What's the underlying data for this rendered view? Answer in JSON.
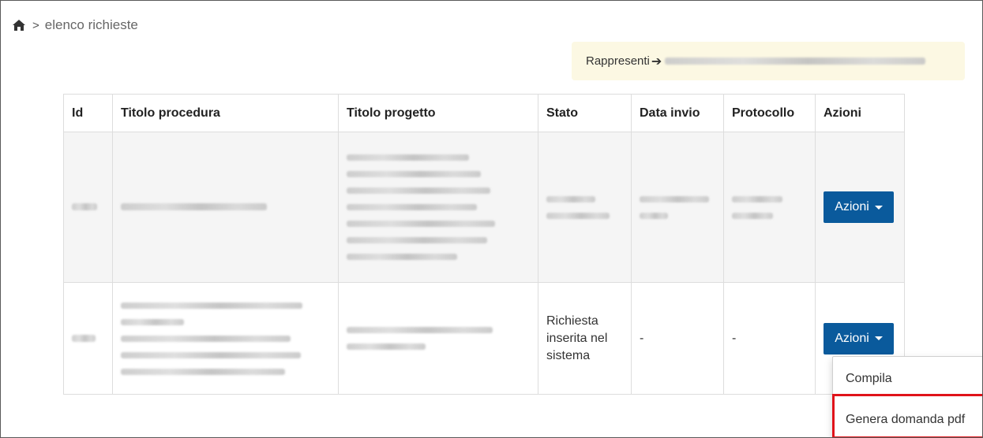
{
  "breadcrumb": {
    "home_icon": "home-icon",
    "separator": ">",
    "current": "elenco richieste"
  },
  "representation": {
    "label": "Rappresenti",
    "arrow": "➔"
  },
  "table": {
    "headers": [
      "Id",
      "Titolo procedura",
      "Titolo progetto",
      "Stato",
      "Data invio",
      "Protocollo",
      "Azioni"
    ],
    "rows": [
      {
        "stato": "",
        "data_invio": "",
        "protocollo": "",
        "action_label": "Azioni"
      },
      {
        "stato": "Richiesta inserita nel sistema",
        "data_invio": "-",
        "protocollo": "-",
        "action_label": "Azioni"
      }
    ]
  },
  "dropdown": {
    "items": [
      "Compila",
      "Genera domanda pdf"
    ]
  },
  "colors": {
    "primary_button": "#0a5a9c",
    "highlight_border": "#e0131a",
    "alert_bg": "#fcf8e3"
  }
}
